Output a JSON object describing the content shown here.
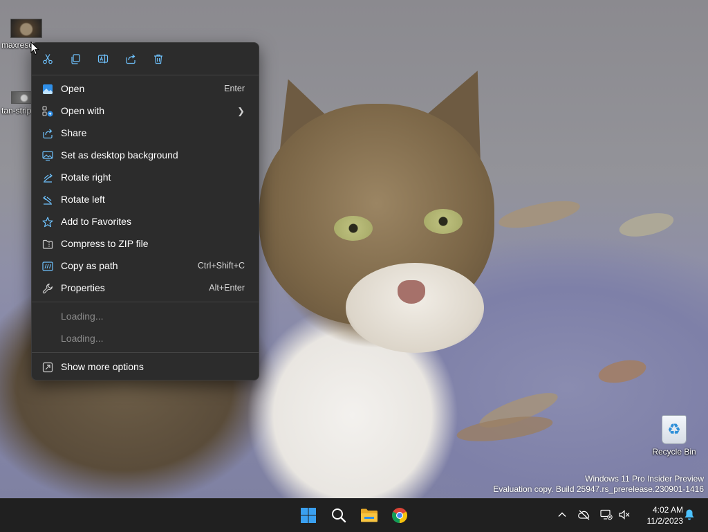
{
  "desktop": {
    "icons": [
      {
        "label": "maxresde"
      },
      {
        "label": "tan-strip"
      },
      {
        "label": "Recycle Bin"
      }
    ],
    "watermark": {
      "line1": "Windows 11 Pro Insider Preview",
      "line2": "Evaluation copy. Build 25947.rs_prerelease.230901-1416"
    }
  },
  "context_menu": {
    "quick_actions": [
      "cut-icon",
      "copy-icon",
      "rename-icon",
      "share-icon",
      "delete-icon"
    ],
    "items": [
      {
        "label": "Open",
        "shortcut": "Enter",
        "icon": "photos-icon"
      },
      {
        "label": "Open with",
        "shortcut": "",
        "icon": "open-with-icon"
      },
      {
        "label": "Share",
        "shortcut": "",
        "icon": "share-icon"
      },
      {
        "label": "Set as desktop background",
        "shortcut": "",
        "icon": "wallpaper-icon"
      },
      {
        "label": "Rotate right",
        "shortcut": "",
        "icon": "rotate-right-icon"
      },
      {
        "label": "Rotate left",
        "shortcut": "",
        "icon": "rotate-left-icon"
      },
      {
        "label": "Add to Favorites",
        "shortcut": "",
        "icon": "star-icon"
      },
      {
        "label": "Compress to ZIP file",
        "shortcut": "",
        "icon": "zip-icon"
      },
      {
        "label": "Copy as path",
        "shortcut": "Ctrl+Shift+C",
        "icon": "path-icon"
      },
      {
        "label": "Properties",
        "shortcut": "Alt+Enter",
        "icon": "wrench-icon"
      },
      {
        "label": "Loading...",
        "shortcut": ""
      },
      {
        "label": "Loading...",
        "shortcut": ""
      },
      {
        "label": "Show more options",
        "shortcut": "",
        "icon": "more-options-icon"
      }
    ]
  },
  "taskbar": {
    "apps": [
      "start-icon",
      "search-icon",
      "file-explorer-icon",
      "chrome-icon"
    ],
    "clock": {
      "time": "4:02 AM",
      "date": "11/2/2023"
    }
  },
  "colors": {
    "accent": "#4cc2ff",
    "menu_bg": "#2c2c2c",
    "taskbar_bg": "#202020"
  }
}
